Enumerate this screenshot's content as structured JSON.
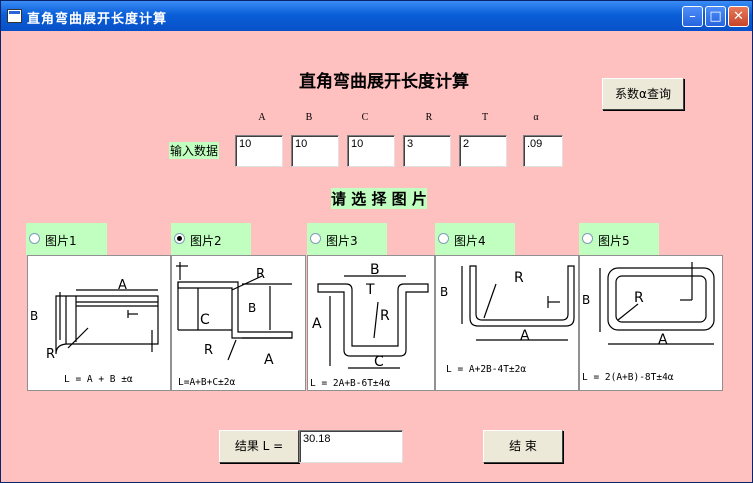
{
  "window": {
    "title": "直角弯曲展开长度计算",
    "min": "–",
    "max": "□",
    "close": "✕"
  },
  "heading": "直角弯曲展开长度计算",
  "query_button": "系数α查询",
  "input_label": "输入数据",
  "columns": [
    {
      "label": "A",
      "value": "10"
    },
    {
      "label": "B",
      "value": "10"
    },
    {
      "label": "C",
      "value": "10"
    },
    {
      "label": "R",
      "value": "3"
    },
    {
      "label": "T",
      "value": "2"
    },
    {
      "label": "α",
      "value": ".09"
    }
  ],
  "select_heading": "请 选 择 图 片",
  "pictures": [
    {
      "label": "图片1",
      "selected": false,
      "formula": "L = A + B ±α"
    },
    {
      "label": "图片2",
      "selected": true,
      "formula": "L=A+B+C±2α"
    },
    {
      "label": "图片3",
      "selected": false,
      "formula": "L = 2A+B-6T±4α"
    },
    {
      "label": "图片4",
      "selected": false,
      "formula": "L = A+2B-4T±2α"
    },
    {
      "label": "图片5",
      "selected": false,
      "formula": "L = 2(A+B)-8T±4α"
    }
  ],
  "diagram_letters": {
    "a": "A",
    "b": "B",
    "c": "C",
    "r": "R",
    "t": "T"
  },
  "result_label": "结果  L =",
  "result_value": "30.18",
  "end_button": "结    束",
  "colors": {
    "background": "#FFC0C0",
    "radio_bg": "#C0FFC0",
    "titlebar": "#0A5FD8"
  },
  "icons": [
    "app-icon",
    "minimize-icon",
    "maximize-icon",
    "close-icon"
  ]
}
